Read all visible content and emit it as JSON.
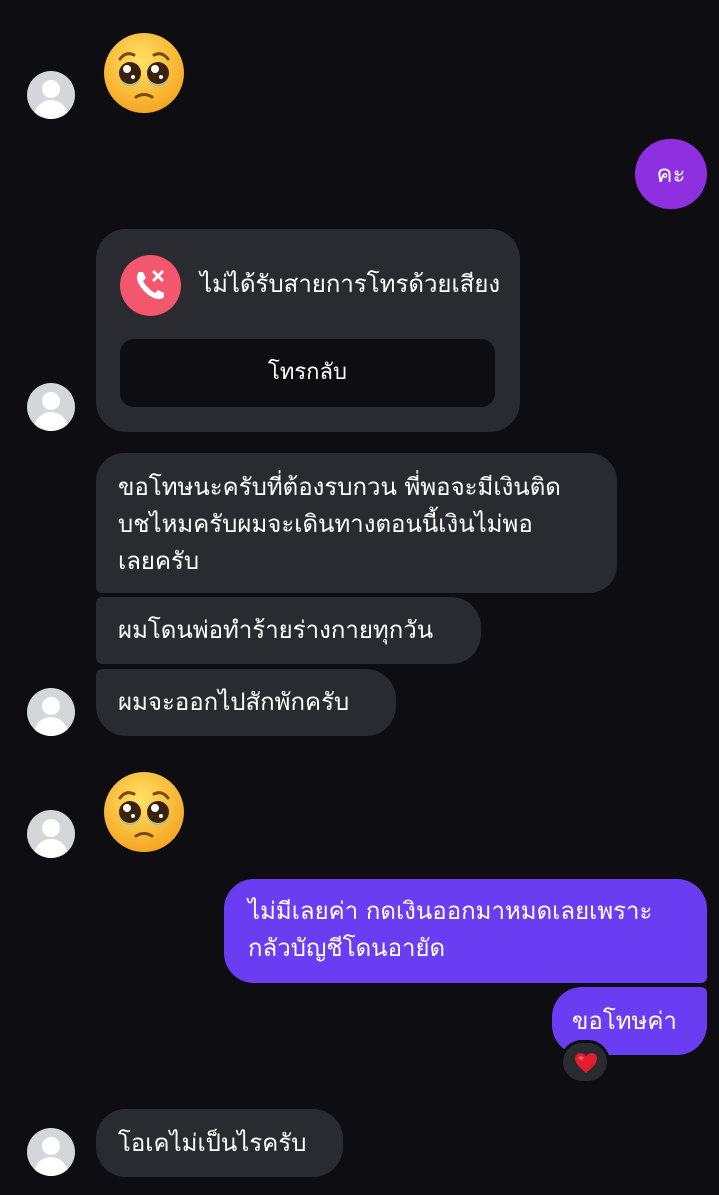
{
  "messages": {
    "outgoing_1": "คะ",
    "missed_call_title": "ไม่ได้รับสายการโทรด้วยเสียง",
    "call_back_label": "โทรกลับ",
    "incoming_1": [
      "ขอโทษนะครับที่ต้องรบกวน พี่พอจะมีเงินติด",
      "บชไหมครับผมจะเดินทางตอนนี้เงินไม่พอ",
      "เลยครับ"
    ],
    "incoming_2": "ผมโดนพ่อทำร้ายร่างกายทุกวัน",
    "incoming_3": "ผมจะออกไปสักพักครับ",
    "outgoing_2": [
      "ไม่มีเลยค่า กดเงินออกมาหมดเลยเพราะ",
      "กลัวบัญชีโดนอายัด"
    ],
    "outgoing_3": "ขอโทษค่า",
    "incoming_4": "โอเคไม่เป็นไรครับ"
  },
  "emoji_1": "pleading-face-emoji",
  "emoji_2": "pleading-face-emoji",
  "reaction": "heart-icon",
  "colors": {
    "background": "#0d0d12",
    "incoming_bubble": "#2a2b31",
    "outgoing_purple": "#6b3df2",
    "outgoing_first": "#8e2fe0",
    "missed_call_red": "#f2576d",
    "avatar_grey": "#d4d6da",
    "heart_red": "#e11d2e"
  }
}
